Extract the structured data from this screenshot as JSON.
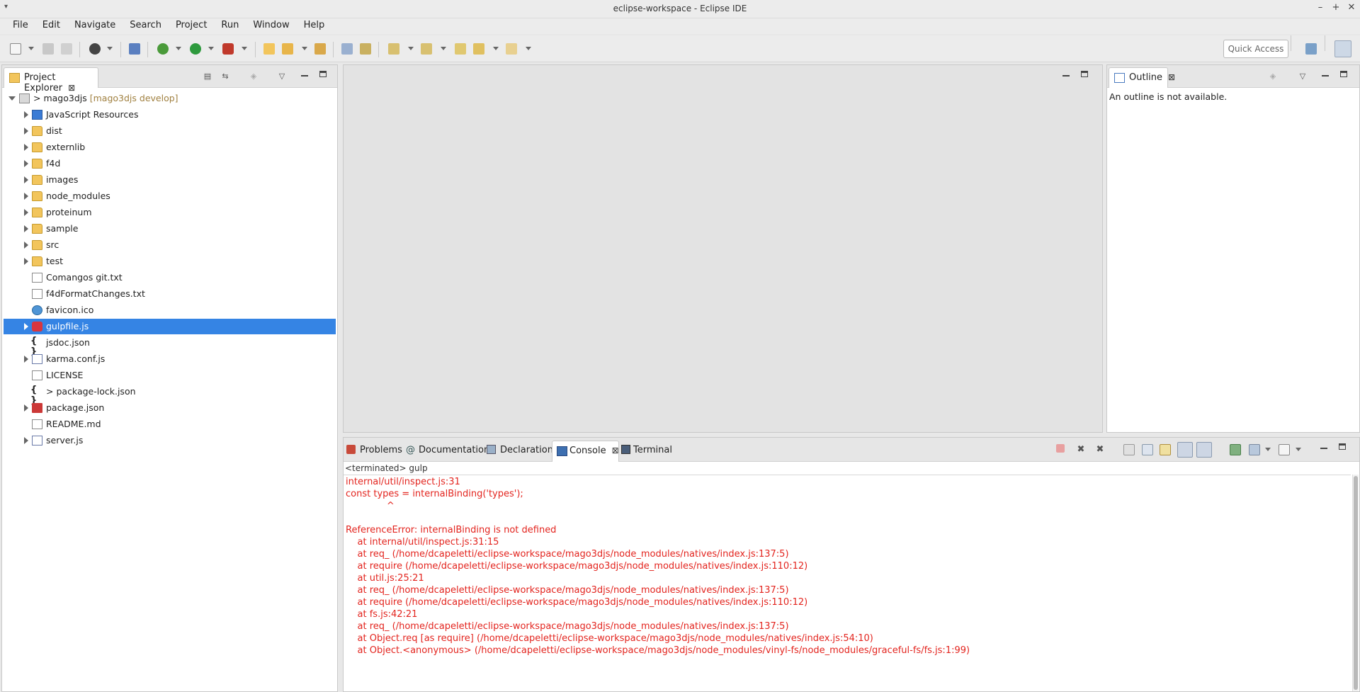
{
  "window": {
    "title": "eclipse-workspace - Eclipse IDE"
  },
  "menubar": [
    "File",
    "Edit",
    "Navigate",
    "Search",
    "Project",
    "Run",
    "Window",
    "Help"
  ],
  "toolbar": {
    "quick_access": "Quick Access"
  },
  "project_explorer": {
    "tab_label": "Project Explorer",
    "root": {
      "label": "mago3djs",
      "decoration": "[mago3djs develop]",
      "prefix": ">"
    },
    "items": [
      {
        "label": "JavaScript Resources",
        "icon": "js-resources-icon",
        "expandable": true
      },
      {
        "label": "dist",
        "icon": "folder-icon",
        "expandable": true
      },
      {
        "label": "externlib",
        "icon": "folder-icon",
        "expandable": true
      },
      {
        "label": "f4d",
        "icon": "folder-icon",
        "expandable": true
      },
      {
        "label": "images",
        "icon": "folder-icon",
        "expandable": true
      },
      {
        "label": "node_modules",
        "icon": "folder-icon",
        "expandable": true
      },
      {
        "label": "proteinum",
        "icon": "folder-icon",
        "expandable": true
      },
      {
        "label": "sample",
        "icon": "folder-icon",
        "expandable": true
      },
      {
        "label": "src",
        "icon": "folder-icon",
        "expandable": true
      },
      {
        "label": "test",
        "icon": "folder-icon",
        "expandable": true
      },
      {
        "label": "Comangos git.txt",
        "icon": "text-file-icon",
        "expandable": false
      },
      {
        "label": "f4dFormatChanges.txt",
        "icon": "text-file-icon",
        "expandable": false
      },
      {
        "label": "favicon.ico",
        "icon": "image-file-icon",
        "expandable": false
      },
      {
        "label": "gulpfile.js",
        "icon": "gulp-icon",
        "expandable": true,
        "selected": true
      },
      {
        "label": "jsdoc.json",
        "icon": "json-file-icon",
        "expandable": false
      },
      {
        "label": "karma.conf.js",
        "icon": "js-file-icon",
        "expandable": true
      },
      {
        "label": "LICENSE",
        "icon": "text-file-icon",
        "expandable": false
      },
      {
        "label": "package-lock.json",
        "icon": "json-file-icon",
        "expandable": false,
        "prefix": ">"
      },
      {
        "label": "package.json",
        "icon": "npm-icon",
        "expandable": true
      },
      {
        "label": "README.md",
        "icon": "text-file-icon",
        "expandable": false
      },
      {
        "label": "server.js",
        "icon": "js-file-icon",
        "expandable": true
      }
    ]
  },
  "outline": {
    "tab_label": "Outline",
    "message": "An outline is not available."
  },
  "bottom_tabs": [
    "Problems",
    "Documentation",
    "Declaration",
    "Console",
    "Terminal"
  ],
  "console": {
    "header": "<terminated> gulp",
    "lines": [
      "internal/util/inspect.js:31",
      "const types = internalBinding('types');",
      "              ^",
      "",
      "ReferenceError: internalBinding is not defined",
      "    at internal/util/inspect.js:31:15",
      "    at req_ (/home/dcapeletti/eclipse-workspace/mago3djs/node_modules/natives/index.js:137:5)",
      "    at require (/home/dcapeletti/eclipse-workspace/mago3djs/node_modules/natives/index.js:110:12)",
      "    at util.js:25:21",
      "    at req_ (/home/dcapeletti/eclipse-workspace/mago3djs/node_modules/natives/index.js:137:5)",
      "    at require (/home/dcapeletti/eclipse-workspace/mago3djs/node_modules/natives/index.js:110:12)",
      "    at fs.js:42:21",
      "    at req_ (/home/dcapeletti/eclipse-workspace/mago3djs/node_modules/natives/index.js:137:5)",
      "    at Object.req [as require] (/home/dcapeletti/eclipse-workspace/mago3djs/node_modules/natives/index.js:54:10)",
      "    at Object.<anonymous> (/home/dcapeletti/eclipse-workspace/mago3djs/node_modules/vinyl-fs/node_modules/graceful-fs/fs.js:1:99)"
    ]
  },
  "colors": {
    "selection": "#3584e4",
    "console_error": "#e3241e",
    "git_decoration": "#a08040"
  }
}
